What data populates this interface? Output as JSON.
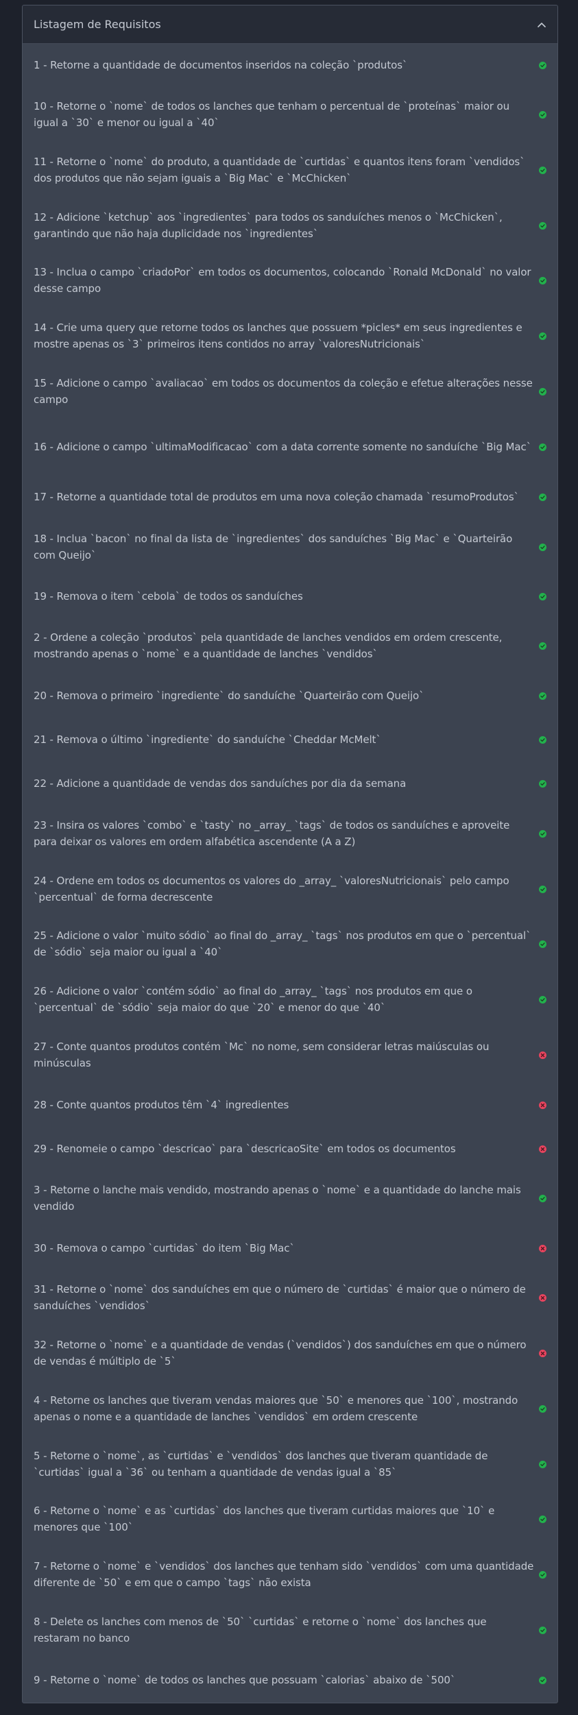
{
  "panel": {
    "title": "Listagem de Requisitos"
  },
  "colors": {
    "pass": "#22b14c",
    "fail": "#e8445e"
  },
  "requirements": [
    {
      "text": "1 - Retorne a quantidade de documentos inseridos na coleção `produtos`",
      "status": "pass"
    },
    {
      "text": "10 - Retorne o `nome` de todos os lanches que tenham o percentual de `proteínas` maior ou igual a `30` e menor ou igual a `40`",
      "status": "pass"
    },
    {
      "text": "11 - Retorne o `nome` do produto, a quantidade de `curtidas` e quantos itens foram `vendidos` dos produtos que não sejam iguais a `Big Mac` e `McChicken`",
      "status": "pass"
    },
    {
      "text": "12 - Adicione `ketchup` aos `ingredientes` para todos os sanduíches menos o `McChicken`, garantindo que não haja duplicidade nos `ingredientes`",
      "status": "pass"
    },
    {
      "text": "13 - Inclua o campo `criadoPor` em todos os documentos, colocando `Ronald McDonald` no valor desse campo",
      "status": "pass"
    },
    {
      "text": "14 - Crie uma query que retorne todos os lanches que possuem *picles* em seus ingredientes e mostre apenas os `3` primeiros itens contidos no array `valoresNutricionais`",
      "status": "pass"
    },
    {
      "text": "15 - Adicione o campo `avaliacao` em todos os documentos da coleção e efetue alterações nesse campo",
      "status": "pass"
    },
    {
      "text": "16 - Adicione o campo `ultimaModificacao` com a data corrente somente no sanduíche `Big Mac`",
      "status": "pass"
    },
    {
      "text": "17 - Retorne a quantidade total de produtos em uma nova coleção chamada `resumoProdutos`",
      "status": "pass"
    },
    {
      "text": "18 - Inclua `bacon` no final da lista de `ingredientes` dos sanduíches `Big Mac` e `Quarteirão com Queijo`",
      "status": "pass"
    },
    {
      "text": "19 - Remova o item `cebola` de todos os sanduíches",
      "status": "pass"
    },
    {
      "text": "2 - Ordene a coleção `produtos` pela quantidade de lanches vendidos em ordem crescente, mostrando apenas o `nome` e a quantidade de lanches `vendidos`",
      "status": "pass"
    },
    {
      "text": "20 - Remova o primeiro `ingrediente` do sanduíche `Quarteirão com Queijo`",
      "status": "pass"
    },
    {
      "text": "21 - Remova o último `ingrediente` do sanduíche `Cheddar McMelt`",
      "status": "pass"
    },
    {
      "text": "22 - Adicione a quantidade de vendas dos sanduíches por dia da semana",
      "status": "pass"
    },
    {
      "text": "23 - Insira os valores `combo` e `tasty` no _array_ `tags` de todos os sanduíches e aproveite para deixar os valores em ordem alfabética ascendente (A a Z)",
      "status": "pass"
    },
    {
      "text": "24 - Ordene em todos os documentos os valores do _array_ `valoresNutricionais` pelo campo `percentual` de forma decrescente",
      "status": "pass"
    },
    {
      "text": "25 - Adicione o valor `muito sódio` ao final do _array_ `tags` nos produtos em que o `percentual` de `sódio` seja maior ou igual a `40`",
      "status": "pass"
    },
    {
      "text": "26 - Adicione o valor `contém sódio` ao final do _array_ `tags` nos produtos em que o `percentual` de `sódio` seja maior do que `20` e menor do que `40`",
      "status": "pass"
    },
    {
      "text": "27 - Conte quantos produtos contém `Mc` no nome, sem considerar letras maiúsculas ou minúsculas",
      "status": "fail"
    },
    {
      "text": "28 - Conte quantos produtos têm `4` ingredientes",
      "status": "fail"
    },
    {
      "text": "29 - Renomeie o campo `descricao` para `descricaoSite` em todos os documentos",
      "status": "fail"
    },
    {
      "text": "3 - Retorne o lanche mais vendido, mostrando apenas o `nome` e a quantidade do lanche mais vendido",
      "status": "pass"
    },
    {
      "text": "30 - Remova o campo `curtidas` do item `Big Mac`",
      "status": "fail"
    },
    {
      "text": "31 - Retorne o `nome` dos sanduíches em que o número de `curtidas` é maior que o número de sanduíches `vendidos`",
      "status": "fail"
    },
    {
      "text": "32 - Retorne o `nome` e a quantidade de vendas (`vendidos`) dos sanduíches em que o número de vendas é múltiplo de `5`",
      "status": "fail"
    },
    {
      "text": "4 - Retorne os lanches que tiveram vendas maiores que `50` e menores que `100`, mostrando apenas o nome e a quantidade de lanches `vendidos` em ordem crescente",
      "status": "pass"
    },
    {
      "text": "5 - Retorne o `nome`, as `curtidas` e `vendidos` dos lanches que tiveram quantidade de `curtidas` igual a `36` ou tenham a quantidade de vendas igual a `85`",
      "status": "pass"
    },
    {
      "text": "6 - Retorne o `nome` e as `curtidas` dos lanches que tiveram curtidas maiores que `10` e menores que `100`",
      "status": "pass"
    },
    {
      "text": "7 - Retorne o `nome` e `vendidos` dos lanches que tenham sido `vendidos` com uma quantidade diferente de `50` e em que o campo `tags` não exista",
      "status": "pass"
    },
    {
      "text": "8 - Delete os lanches com menos de `50` `curtidas` e retorne o `nome` dos lanches que restaram no banco",
      "status": "pass"
    },
    {
      "text": "9 - Retorne o `nome` de todos os lanches que possuam `calorias` abaixo de `500`",
      "status": "pass"
    }
  ]
}
